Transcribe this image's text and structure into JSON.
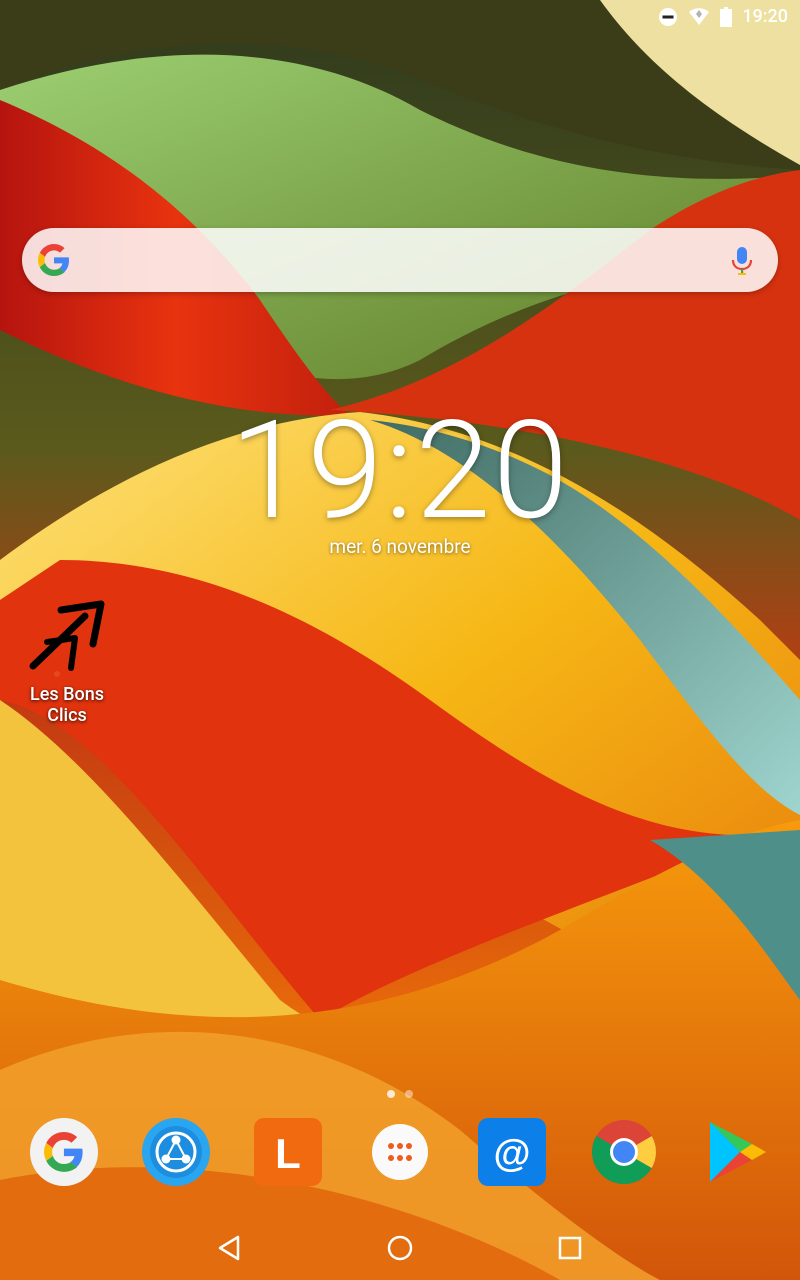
{
  "status_bar": {
    "time": "19:20",
    "icons": [
      "do-not-disturb-icon",
      "wifi-icon",
      "battery-icon"
    ]
  },
  "search": {
    "provider": "Google"
  },
  "clock": {
    "time": "19:20",
    "date": "mer. 6 novembre"
  },
  "shortcut": {
    "label": "Les Bons Clics",
    "icon": "arrow-cursor-icon"
  },
  "pages": {
    "count": 2,
    "current": 1
  },
  "dock": [
    {
      "icon": "google-app-icon"
    },
    {
      "icon": "shareit-icon"
    },
    {
      "icon": "launcher-l-icon",
      "letter": "L"
    },
    {
      "icon": "app-drawer-icon"
    },
    {
      "icon": "email-icon",
      "symbol": "@"
    },
    {
      "icon": "chrome-icon"
    },
    {
      "icon": "play-store-icon"
    }
  ],
  "navigation": [
    "back-icon",
    "home-icon",
    "recents-icon"
  ]
}
